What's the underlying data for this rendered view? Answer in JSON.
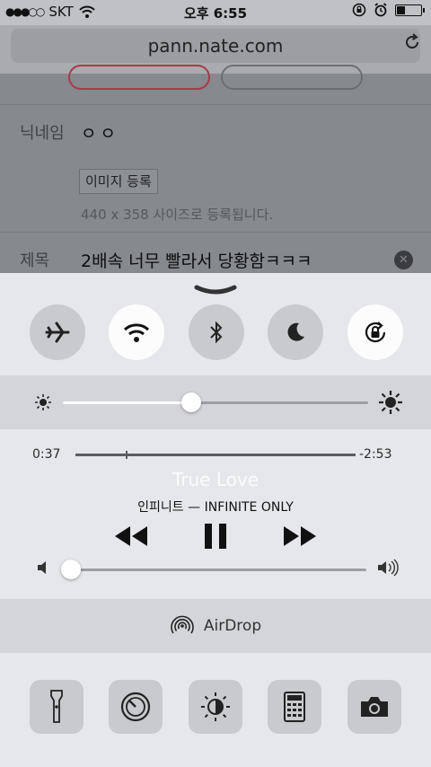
{
  "status_bar": {
    "signal_dots": "●●●○○",
    "carrier": "SKT",
    "time": "오후 6:55",
    "battery_level": 0.35
  },
  "browser": {
    "url": "pann.nate.com"
  },
  "page": {
    "nickname_label": "닉네임",
    "nickname_value": "ㅇㅇ",
    "image_button": "이미지 등록",
    "size_note": "440 x 358 사이즈로 등록됩니다.",
    "title_label": "제목",
    "title_value": "2배속 너무 빨라서 당황함ㅋㅋㅋ"
  },
  "control_center": {
    "toggles": [
      {
        "name": "airplane-mode",
        "icon": "airplane-icon",
        "on": false
      },
      {
        "name": "wifi",
        "icon": "wifi-icon",
        "on": true
      },
      {
        "name": "bluetooth",
        "icon": "bluetooth-icon",
        "on": false
      },
      {
        "name": "do-not-disturb",
        "icon": "moon-icon",
        "on": false
      },
      {
        "name": "rotation-lock",
        "icon": "rotation-lock-icon",
        "on": true
      }
    ],
    "brightness_level": 0.42,
    "media": {
      "elapsed": "0:37",
      "remaining": "-2:53",
      "progress": 0.18,
      "title": "True Love",
      "artist_album": "인피니트 — INFINITE ONLY",
      "volume_level": 0.02
    },
    "airdrop_label": "AirDrop",
    "tools": [
      "flashlight-icon",
      "timer-icon",
      "night-shift-icon",
      "calculator-icon",
      "camera-icon"
    ]
  },
  "colors": {
    "accent_border": "#aa3a4a",
    "toggle_on": "#fcfcfc",
    "toggle_off": "#c9cacd"
  }
}
